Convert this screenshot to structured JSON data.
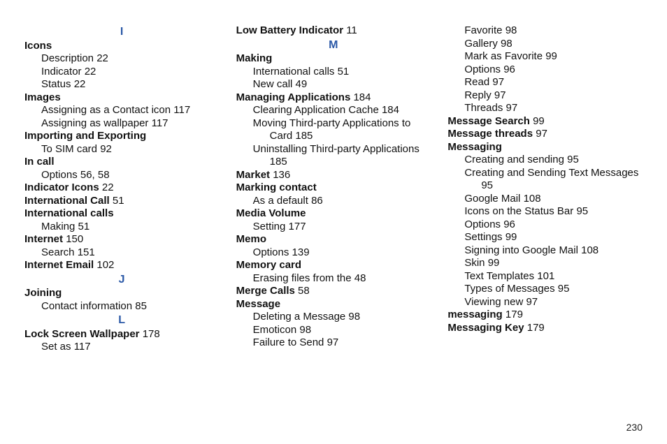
{
  "page_number": "230",
  "columns": [
    [
      {
        "type": "letter",
        "text": "I"
      },
      {
        "type": "entry",
        "indent": 0,
        "bold": true,
        "label": "Icons",
        "page": ""
      },
      {
        "type": "entry",
        "indent": 1,
        "bold": false,
        "label": "Description",
        "page": "22"
      },
      {
        "type": "entry",
        "indent": 1,
        "bold": false,
        "label": "Indicator",
        "page": "22"
      },
      {
        "type": "entry",
        "indent": 1,
        "bold": false,
        "label": "Status",
        "page": "22"
      },
      {
        "type": "entry",
        "indent": 0,
        "bold": true,
        "label": "Images",
        "page": ""
      },
      {
        "type": "entry",
        "indent": 1,
        "bold": false,
        "label": "Assigning as a Contact icon",
        "page": "117"
      },
      {
        "type": "entry",
        "indent": 1,
        "bold": false,
        "label": "Assigning as wallpaper",
        "page": "117"
      },
      {
        "type": "entry",
        "indent": 0,
        "bold": true,
        "label": "Importing and Exporting",
        "page": ""
      },
      {
        "type": "entry",
        "indent": 1,
        "bold": false,
        "label": "To SIM card",
        "page": "92"
      },
      {
        "type": "entry",
        "indent": 0,
        "bold": true,
        "label": "In call",
        "page": ""
      },
      {
        "type": "entry",
        "indent": 1,
        "bold": false,
        "label": "Options",
        "page": "56, 58"
      },
      {
        "type": "entry",
        "indent": 0,
        "bold": true,
        "label": "Indicator Icons",
        "page": "22"
      },
      {
        "type": "entry",
        "indent": 0,
        "bold": true,
        "label": "International Call",
        "page": "51"
      },
      {
        "type": "entry",
        "indent": 0,
        "bold": true,
        "label": "International calls",
        "page": ""
      },
      {
        "type": "entry",
        "indent": 1,
        "bold": false,
        "label": "Making",
        "page": "51"
      },
      {
        "type": "entry",
        "indent": 0,
        "bold": true,
        "label": "Internet",
        "page": "150"
      },
      {
        "type": "entry",
        "indent": 1,
        "bold": false,
        "label": "Search",
        "page": "151"
      },
      {
        "type": "entry",
        "indent": 0,
        "bold": true,
        "label": "Internet Email",
        "page": "102"
      },
      {
        "type": "letter",
        "text": "J"
      },
      {
        "type": "entry",
        "indent": 0,
        "bold": true,
        "label": "Joining",
        "page": ""
      },
      {
        "type": "entry",
        "indent": 1,
        "bold": false,
        "label": "Contact information",
        "page": "85"
      },
      {
        "type": "letter",
        "text": "L"
      },
      {
        "type": "entry",
        "indent": 0,
        "bold": true,
        "label": "Lock Screen Wallpaper",
        "page": "178"
      },
      {
        "type": "entry",
        "indent": 1,
        "bold": false,
        "label": "Set as",
        "page": "117"
      }
    ],
    [
      {
        "type": "entry",
        "indent": 0,
        "bold": true,
        "label": "Low Battery Indicator",
        "page": "11"
      },
      {
        "type": "letter",
        "text": "M"
      },
      {
        "type": "entry",
        "indent": 0,
        "bold": true,
        "label": "Making",
        "page": ""
      },
      {
        "type": "entry",
        "indent": 1,
        "bold": false,
        "label": "International calls",
        "page": "51"
      },
      {
        "type": "entry",
        "indent": 1,
        "bold": false,
        "label": "New call",
        "page": "49"
      },
      {
        "type": "entry",
        "indent": 0,
        "bold": true,
        "label": "Managing Applications",
        "page": "184"
      },
      {
        "type": "entry",
        "indent": 1,
        "bold": false,
        "label": "Clearing Application Cache",
        "page": "184"
      },
      {
        "type": "entry",
        "indent": 1,
        "bold": false,
        "label": "Moving Third-party Applications to Card",
        "page": "185"
      },
      {
        "type": "entry",
        "indent": 1,
        "bold": false,
        "label": "Uninstalling Third-party Applications",
        "page": "185"
      },
      {
        "type": "entry",
        "indent": 0,
        "bold": true,
        "label": "Market",
        "page": "136"
      },
      {
        "type": "entry",
        "indent": 0,
        "bold": true,
        "label": "Marking contact",
        "page": ""
      },
      {
        "type": "entry",
        "indent": 1,
        "bold": false,
        "label": "As a default",
        "page": "86"
      },
      {
        "type": "entry",
        "indent": 0,
        "bold": true,
        "label": "Media Volume",
        "page": ""
      },
      {
        "type": "entry",
        "indent": 1,
        "bold": false,
        "label": "Setting",
        "page": "177"
      },
      {
        "type": "entry",
        "indent": 0,
        "bold": true,
        "label": "Memo",
        "page": ""
      },
      {
        "type": "entry",
        "indent": 1,
        "bold": false,
        "label": "Options",
        "page": "139"
      },
      {
        "type": "entry",
        "indent": 0,
        "bold": true,
        "label": "Memory card",
        "page": ""
      },
      {
        "type": "entry",
        "indent": 1,
        "bold": false,
        "label": "Erasing files from the",
        "page": "48"
      },
      {
        "type": "entry",
        "indent": 0,
        "bold": true,
        "label": "Merge Calls",
        "page": "58"
      },
      {
        "type": "entry",
        "indent": 0,
        "bold": true,
        "label": "Message",
        "page": ""
      },
      {
        "type": "entry",
        "indent": 1,
        "bold": false,
        "label": "Deleting a Message",
        "page": "98"
      },
      {
        "type": "entry",
        "indent": 1,
        "bold": false,
        "label": "Emoticon",
        "page": "98"
      },
      {
        "type": "entry",
        "indent": 1,
        "bold": false,
        "label": "Failure to Send",
        "page": "97"
      }
    ],
    [
      {
        "type": "entry",
        "indent": 1,
        "bold": false,
        "label": "Favorite",
        "page": "98"
      },
      {
        "type": "entry",
        "indent": 1,
        "bold": false,
        "label": "Gallery",
        "page": "98"
      },
      {
        "type": "entry",
        "indent": 1,
        "bold": false,
        "label": "Mark as Favorite",
        "page": "99"
      },
      {
        "type": "entry",
        "indent": 1,
        "bold": false,
        "label": "Options",
        "page": "96"
      },
      {
        "type": "entry",
        "indent": 1,
        "bold": false,
        "label": "Read",
        "page": "97"
      },
      {
        "type": "entry",
        "indent": 1,
        "bold": false,
        "label": "Reply",
        "page": "97"
      },
      {
        "type": "entry",
        "indent": 1,
        "bold": false,
        "label": "Threads",
        "page": "97"
      },
      {
        "type": "entry",
        "indent": 0,
        "bold": true,
        "label": "Message Search",
        "page": "99"
      },
      {
        "type": "entry",
        "indent": 0,
        "bold": true,
        "label": "Message threads",
        "page": "97"
      },
      {
        "type": "entry",
        "indent": 0,
        "bold": true,
        "label": "Messaging",
        "page": ""
      },
      {
        "type": "entry",
        "indent": 1,
        "bold": false,
        "label": "Creating and sending",
        "page": "95"
      },
      {
        "type": "entry",
        "indent": 1,
        "bold": false,
        "label": "Creating and Sending Text Messages",
        "page": "95"
      },
      {
        "type": "entry",
        "indent": 1,
        "bold": false,
        "label": "Google Mail",
        "page": "108"
      },
      {
        "type": "entry",
        "indent": 1,
        "bold": false,
        "label": "Icons on the Status Bar",
        "page": "95"
      },
      {
        "type": "entry",
        "indent": 1,
        "bold": false,
        "label": "Options",
        "page": "96"
      },
      {
        "type": "entry",
        "indent": 1,
        "bold": false,
        "label": "Settings",
        "page": "99"
      },
      {
        "type": "entry",
        "indent": 1,
        "bold": false,
        "label": "Signing into Google Mail",
        "page": "108"
      },
      {
        "type": "entry",
        "indent": 1,
        "bold": false,
        "label": "Skin",
        "page": "99"
      },
      {
        "type": "entry",
        "indent": 1,
        "bold": false,
        "label": "Text Templates",
        "page": "101"
      },
      {
        "type": "entry",
        "indent": 1,
        "bold": false,
        "label": "Types of Messages",
        "page": "95"
      },
      {
        "type": "entry",
        "indent": 1,
        "bold": false,
        "label": "Viewing new",
        "page": "97"
      },
      {
        "type": "entry",
        "indent": 0,
        "bold": true,
        "label": "messaging",
        "page": "179"
      },
      {
        "type": "entry",
        "indent": 0,
        "bold": true,
        "label": "Messaging Key",
        "page": "179"
      }
    ]
  ]
}
